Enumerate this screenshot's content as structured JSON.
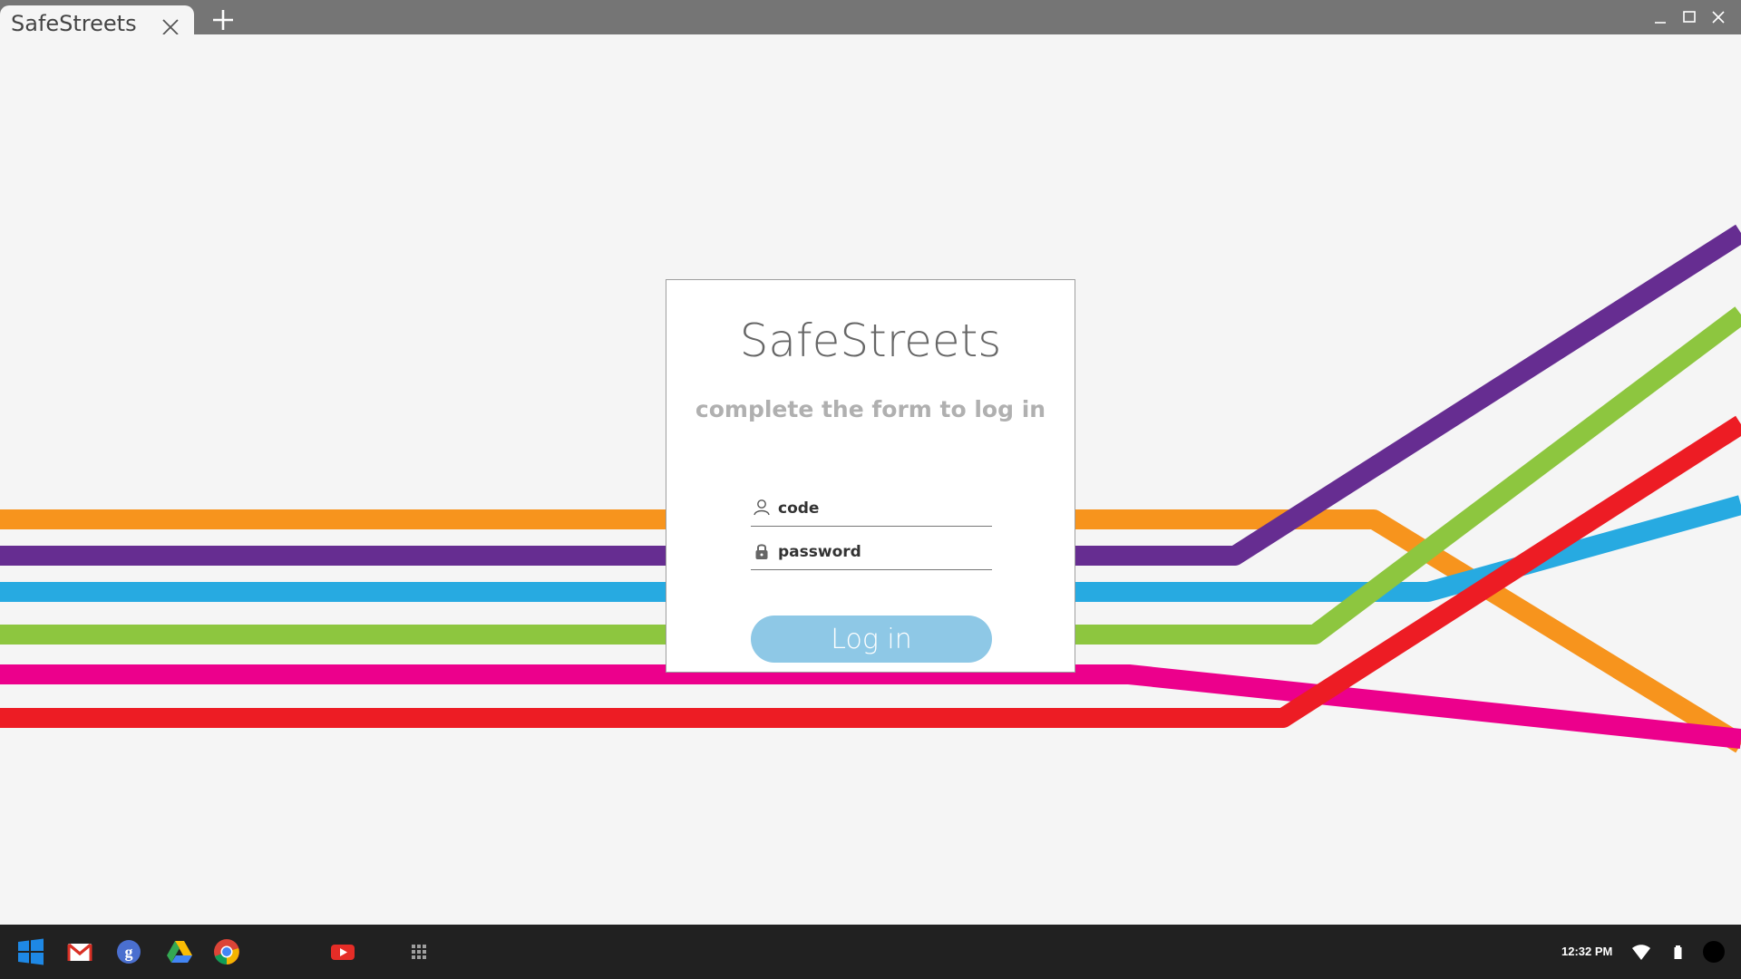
{
  "browser": {
    "tab_title": "SafeStreets",
    "icons": [
      "close-icon",
      "plus-icon",
      "minimize-icon",
      "maximize-icon",
      "close-window-icon"
    ]
  },
  "login": {
    "brand": "SafeStreets",
    "subtitle": "complete the form to log in",
    "code_placeholder": "code",
    "password_placeholder": "password",
    "button_label": "Log in",
    "button_color": "#8ec8e6"
  },
  "background_lines": {
    "colors": [
      "#f7941d",
      "#662d91",
      "#27aae1",
      "#8dc63f",
      "#ec008c",
      "#ed1c24"
    ]
  },
  "taskbar": {
    "apps": [
      "windows-icon",
      "gmail-icon",
      "google-icon",
      "drive-icon",
      "chrome-icon",
      "youtube-icon",
      "app-launcher-icon"
    ],
    "clock": "12:32 PM",
    "status_icons": [
      "wifi-icon",
      "battery-icon",
      "account-icon"
    ]
  }
}
